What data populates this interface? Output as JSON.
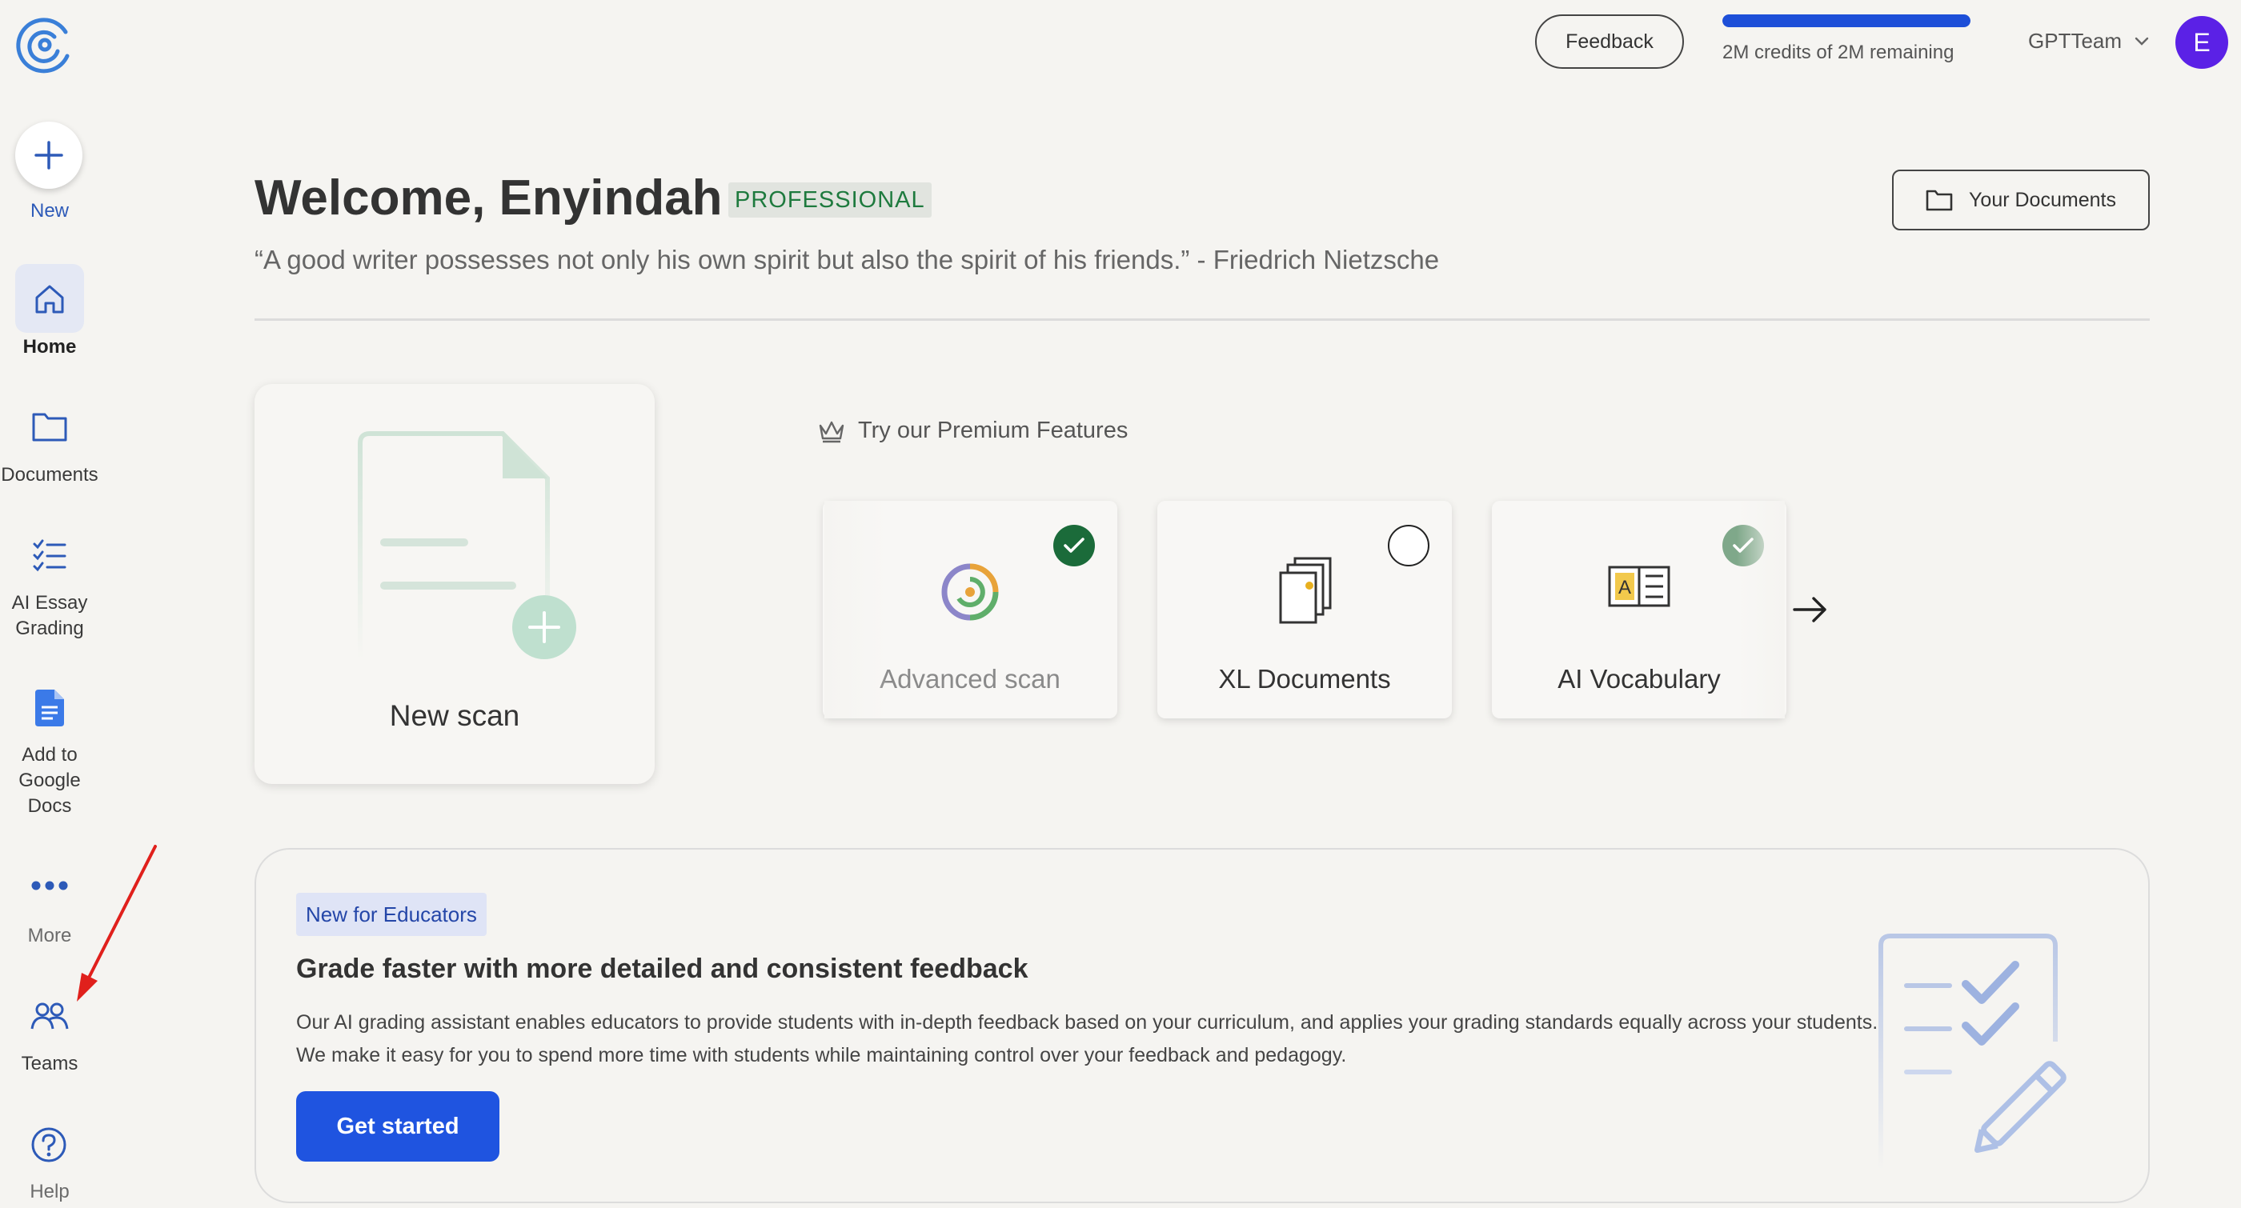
{
  "sidebar": {
    "new_label": "New",
    "items": [
      {
        "label": "Home",
        "icon": "home-icon",
        "active": true
      },
      {
        "label": "Documents",
        "icon": "folder-icon"
      },
      {
        "label": "AI Essay\nGrading",
        "icon": "checklist-icon"
      },
      {
        "label": "Add to\nGoogle\nDocs",
        "icon": "google-docs-icon"
      },
      {
        "label": "More",
        "icon": "more-dots-icon"
      },
      {
        "label": "Teams",
        "icon": "teams-icon"
      },
      {
        "label": "Help",
        "icon": "help-icon"
      }
    ]
  },
  "topbar": {
    "feedback_label": "Feedback",
    "credits_text": "2M credits of 2M remaining",
    "credits_fraction": 1.0,
    "team_name": "GPTTeam",
    "avatar_initial": "E"
  },
  "header": {
    "welcome": "Welcome, Enyindah",
    "plan_badge": "PROFESSIONAL",
    "quote": "“A good writer possesses not only his own spirit but also the spirit of his friends.” - Friedrich Nietzsche",
    "your_documents_label": "Your Documents"
  },
  "scan_card": {
    "label": "New scan"
  },
  "premium": {
    "title": "Try our Premium Features",
    "features": [
      {
        "name": "Advanced scan",
        "state": "checked-dark"
      },
      {
        "name": "XL Documents",
        "state": "unchecked"
      },
      {
        "name": "AI Vocabulary",
        "state": "checked-light"
      }
    ]
  },
  "educators": {
    "badge": "New for Educators",
    "title": "Grade faster with more detailed and consistent feedback",
    "description": "Our AI grading assistant enables educators to provide students with in-depth feedback based on your curriculum, and applies your grading standards equally across your students. We make it easy for you to spend more time with students while maintaining control over your feedback and pedagogy.",
    "cta_label": "Get started"
  },
  "colors": {
    "accent": "#1f54e0",
    "credits_bar": "#1d4fd8",
    "avatar": "#5b21e6",
    "check_dark": "#1b6b3a",
    "check_light": "#7fa88a",
    "annotation": "#e0201c"
  }
}
